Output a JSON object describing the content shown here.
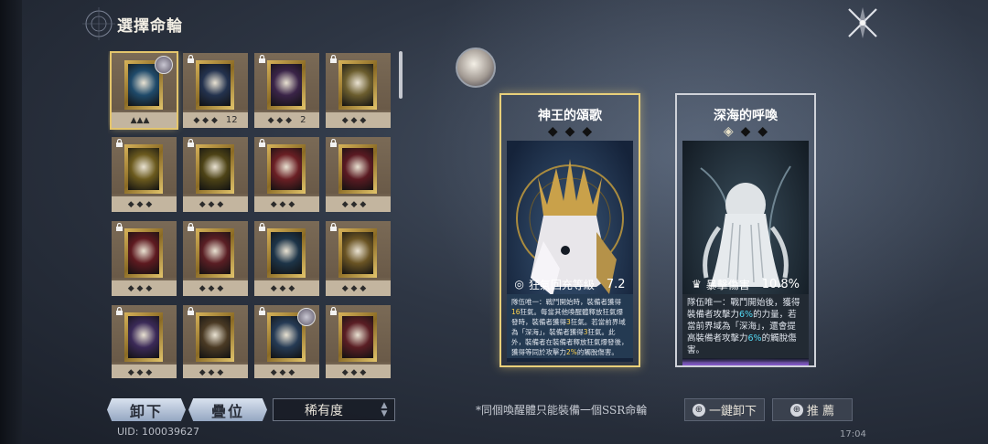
{
  "title": "選擇命輪",
  "cards": [
    {
      "id": "c1",
      "row": 0,
      "col": 0,
      "selected": true,
      "locked": false,
      "portrait": true,
      "stars": "▲▲▲",
      "count": "",
      "color": "#1f4a6a",
      "icon": "white-figure-icon"
    },
    {
      "id": "c2",
      "row": 0,
      "col": 1,
      "locked": true,
      "stars": "◆ ◆ ◆",
      "count": "12",
      "color": "#23324e",
      "icon": "lady-portrait-icon"
    },
    {
      "id": "c3",
      "row": 0,
      "col": 2,
      "locked": true,
      "stars": "◆ ◆ ◆",
      "count": "2",
      "color": "#3a2448",
      "icon": "mask-icon"
    },
    {
      "id": "c4",
      "row": 0,
      "col": 3,
      "locked": true,
      "stars": "◆ ◆ ◆",
      "count": "",
      "color": "#6b5d2e",
      "icon": "whale-icon"
    },
    {
      "id": "c5",
      "row": 1,
      "col": 0,
      "locked": true,
      "stars": "◆ ◆ ◆",
      "count": "",
      "color": "#6b5a1e",
      "icon": "horse-icon"
    },
    {
      "id": "c6",
      "row": 1,
      "col": 1,
      "locked": true,
      "stars": "◆ ◆ ◆",
      "count": "",
      "color": "#4d4316",
      "icon": "spears-icon"
    },
    {
      "id": "c7",
      "row": 1,
      "col": 2,
      "locked": true,
      "stars": "◆ ◆ ◆",
      "count": "",
      "color": "#6a1f24",
      "icon": "jester-icon"
    },
    {
      "id": "c8",
      "row": 1,
      "col": 3,
      "locked": true,
      "stars": "◆ ◆ ◆",
      "count": "",
      "color": "#5a1a22",
      "icon": "rose-icon"
    },
    {
      "id": "c9",
      "row": 2,
      "col": 0,
      "locked": true,
      "stars": "◆ ◆ ◆",
      "count": "",
      "color": "#5e1a20",
      "icon": "vial-icon"
    },
    {
      "id": "c10",
      "row": 2,
      "col": 1,
      "locked": true,
      "stars": "◆ ◆ ◆",
      "count": "",
      "color": "#5a1e24",
      "icon": "tarot-icon"
    },
    {
      "id": "c11",
      "row": 2,
      "col": 2,
      "locked": true,
      "stars": "◆ ◆ ◆",
      "count": "",
      "color": "#1d3448",
      "icon": "wheel-icon"
    },
    {
      "id": "c12",
      "row": 2,
      "col": 3,
      "locked": true,
      "stars": "◆ ◆ ◆",
      "count": "",
      "color": "#6a5424",
      "icon": "lily-icon"
    },
    {
      "id": "c13",
      "row": 3,
      "col": 0,
      "locked": true,
      "stars": "◆ ◆ ◆",
      "count": "",
      "color": "#3b2a58",
      "icon": "eye-icon"
    },
    {
      "id": "c14",
      "row": 3,
      "col": 1,
      "locked": true,
      "stars": "◆ ◆ ◆",
      "count": "",
      "color": "#4a3a24",
      "icon": "teacup-icon"
    },
    {
      "id": "c15",
      "row": 3,
      "col": 2,
      "locked": true,
      "portrait": true,
      "stars": "◆ ◆ ◆",
      "count": "",
      "color": "#253a54",
      "icon": "sword-icon"
    },
    {
      "id": "c16",
      "row": 3,
      "col": 3,
      "locked": true,
      "stars": "◆ ◆ ◆",
      "count": "",
      "color": "#5a1e24",
      "icon": "rabbit-icon"
    }
  ],
  "buttons": {
    "unequip": "卸下",
    "stack": "疊位",
    "rarity": "稀有度"
  },
  "uid": "UID: 100039627",
  "equipped": [
    {
      "name": "神王的頌歌",
      "stat_label": "狂氣回充等級",
      "stat_value": "7.2",
      "desc_parts": [
        [
          "隊伍唯一：戰鬥開始時，裝備者獲得",
          ""
        ],
        [
          "16",
          "hl"
        ],
        [
          "狂氣。每當其他喚醒體釋放狂氣爆發時，裝備者獲得",
          ""
        ],
        [
          "3",
          "hl"
        ],
        [
          "狂氣。若當前界域為「深海」，裝備者獲得",
          ""
        ],
        [
          "3",
          "hl"
        ],
        [
          "狂氣。此外，裝備者在裝備者釋放狂氣爆發後，獲得等同於攻擊力",
          ""
        ],
        [
          "2%",
          "hl"
        ],
        [
          "的觸脫傷害。",
          ""
        ]
      ]
    },
    {
      "name": "深海的呼喚",
      "stat_label": "暴擊傷害",
      "stat_value": "10.8%",
      "desc_parts": [
        [
          "隊伍唯一：戰鬥開始後，獲得裝備者攻擊力",
          ""
        ],
        [
          "6%",
          "hl2"
        ],
        [
          "的力量，若當前界域為「深海」，還會提高裝備者攻擊力",
          ""
        ],
        [
          "6%",
          "hl2"
        ],
        [
          "的觸脫傷害。",
          ""
        ]
      ]
    }
  ],
  "note": "*同個喚醒體只能裝備一個SSR命輪",
  "actions": {
    "unequip_all": "一鍵卸下",
    "recommend": "推 薦"
  },
  "time": "17:04"
}
